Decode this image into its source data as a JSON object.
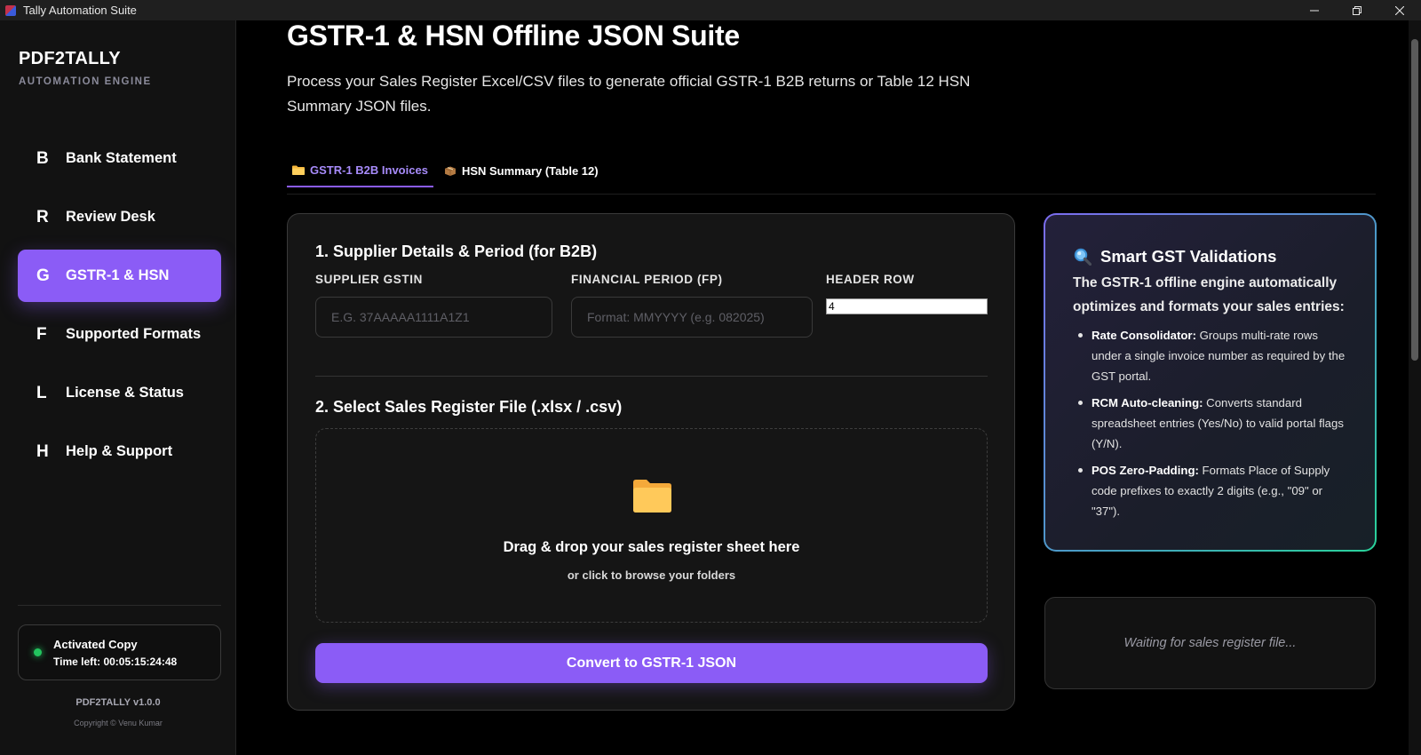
{
  "window": {
    "title": "Tally Automation Suite",
    "controls": [
      "minimize",
      "restore",
      "close"
    ]
  },
  "sidebar": {
    "brand": "PDF2TALLY",
    "subtitle": "AUTOMATION ENGINE",
    "items": [
      {
        "letter": "B",
        "label": "Bank Statement",
        "active": false
      },
      {
        "letter": "R",
        "label": "Review Desk",
        "active": false
      },
      {
        "letter": "G",
        "label": "GSTR-1 & HSN",
        "active": true
      },
      {
        "letter": "F",
        "label": "Supported Formats",
        "active": false
      },
      {
        "letter": "L",
        "label": "License & Status",
        "active": false
      },
      {
        "letter": "H",
        "label": "Help & Support",
        "active": false
      }
    ],
    "status": {
      "title": "Activated Copy",
      "time_left": "Time left: 00:05:15:24:48"
    },
    "version": "PDF2TALLY v1.0.0",
    "copyright": "Copyright © Venu Kumar"
  },
  "main": {
    "title": "GSTR-1 & HSN Offline JSON Suite",
    "description": "Process your Sales Register Excel/CSV files to generate official GSTR-1 B2B returns or Table 12 HSN Summary JSON files.",
    "tabs": [
      {
        "label": "GSTR-1 B2B Invoices",
        "icon": "folder-icon",
        "active": true
      },
      {
        "label": "HSN Summary (Table 12)",
        "icon": "package-icon",
        "active": false
      }
    ],
    "section1": {
      "title": "1. Supplier Details & Period (for B2B)",
      "gstin_label": "SUPPLIER GSTIN",
      "gstin_placeholder": "E.G. 37AAAAA1111A1Z1",
      "period_label": "FINANCIAL PERIOD (FP)",
      "period_placeholder": "Format: MMYYYY (e.g. 082025)",
      "header_row_label": "HEADER ROW",
      "header_row_value": "4"
    },
    "section2": {
      "title": "2. Select Sales Register File (.xlsx / .csv)",
      "drop_main": "Drag & drop your sales register sheet here",
      "drop_sub": "or click to browse your folders"
    },
    "convert_button": "Convert to GSTR-1 JSON"
  },
  "info": {
    "title": "Smart GST Validations",
    "description": "The GSTR-1 offline engine automatically optimizes and formats your sales entries:",
    "items": [
      {
        "bold": "Rate Consolidator:",
        "text": " Groups multi-rate rows under a single invoice number as required by the GST portal."
      },
      {
        "bold": "RCM Auto-cleaning:",
        "text": " Converts standard spreadsheet entries (Yes/No) to valid portal flags (Y/N)."
      },
      {
        "bold": "POS Zero-Padding:",
        "text": " Formats Place of Supply code prefixes to exactly 2 digits (e.g., \"09\" or \"37\")."
      }
    ]
  },
  "waiting": {
    "text": "Waiting for sales register file..."
  },
  "colors": {
    "accent": "#8b5cf6",
    "status_green": "#22c55e",
    "background": "#000000",
    "sidebar": "#121212"
  }
}
